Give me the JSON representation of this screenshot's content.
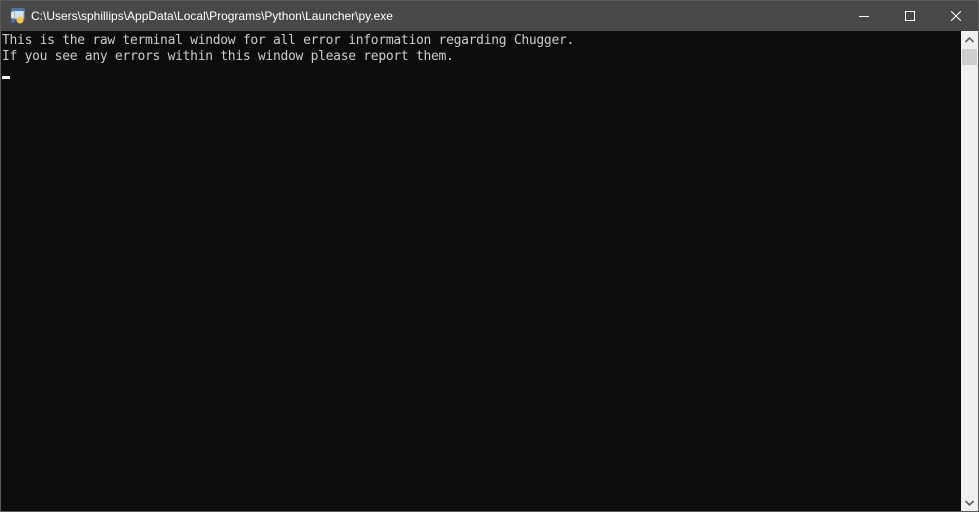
{
  "window": {
    "title": "C:\\Users\\sphillips\\AppData\\Local\\Programs\\Python\\Launcher\\py.exe",
    "icon": "python-launcher-icon",
    "controls": [
      "minimize",
      "maximize",
      "close"
    ]
  },
  "terminal": {
    "lines": [
      "This is the raw terminal window for all error information regarding Chugger.",
      "If you see any errors within this window please report them."
    ],
    "background": "#0c0c0c",
    "foreground": "#cccccc"
  },
  "scrollbar": {
    "position_fraction": 0.0
  }
}
